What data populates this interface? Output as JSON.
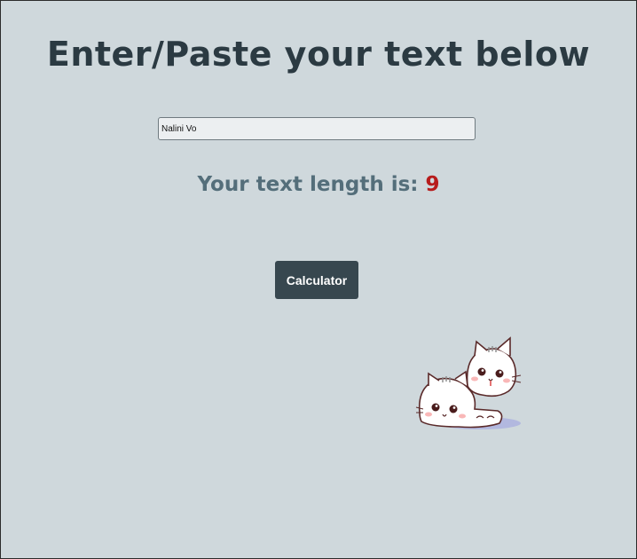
{
  "header": {
    "title": "Enter/Paste your text below"
  },
  "input": {
    "value": "Nalini Vo",
    "placeholder": ""
  },
  "result": {
    "label": "Your text length is:",
    "value": "9"
  },
  "actions": {
    "calculate_label": "Calculator"
  },
  "decoration": {
    "icon": "two-kittens-icon"
  },
  "colors": {
    "background": "#cfd8dc",
    "title": "#2b3a42",
    "label": "#546e7a",
    "value": "#b71c1c",
    "button": "#37474f"
  }
}
